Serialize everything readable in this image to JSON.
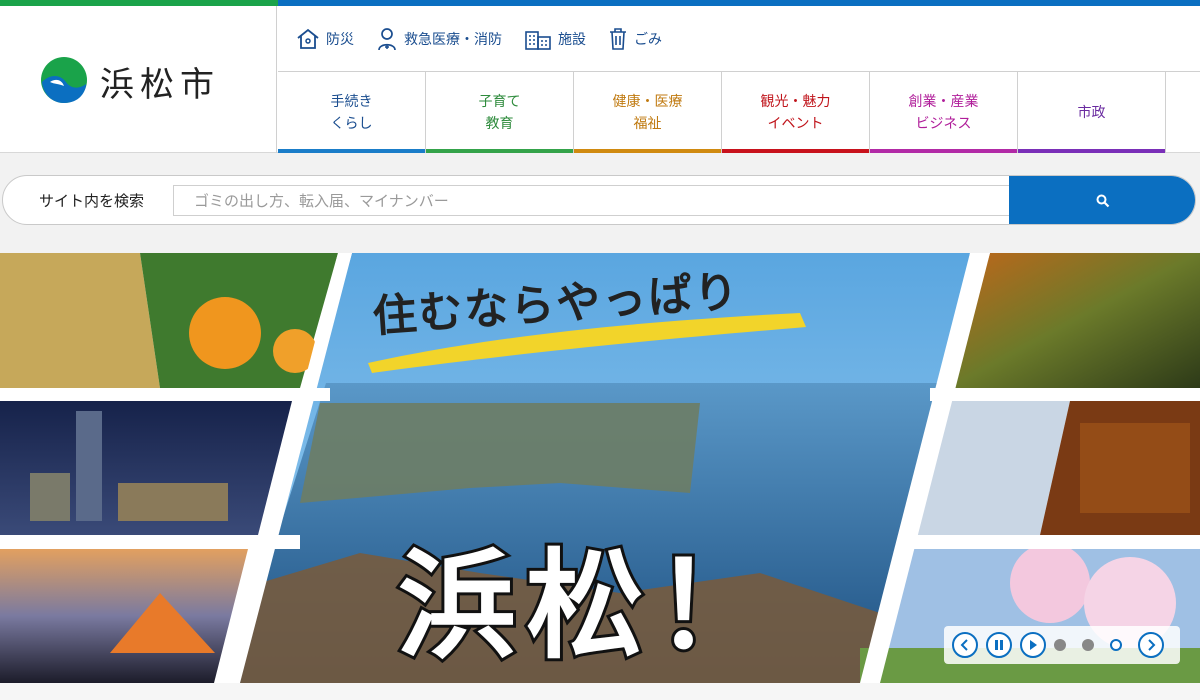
{
  "site": {
    "name": "浜松市"
  },
  "util_nav": [
    {
      "label": "防災",
      "icon": "house-icon"
    },
    {
      "label": "救急医療・消防",
      "icon": "medical-staff-icon"
    },
    {
      "label": "施設",
      "icon": "building-icon"
    },
    {
      "label": "ごみ",
      "icon": "trash-icon"
    }
  ],
  "main_nav": [
    {
      "label": "手続き\nくらし",
      "color": "#1a4d8f",
      "bar": "#1a7dc9"
    },
    {
      "label": "子育て\n教育",
      "color": "#2e8b3c",
      "bar": "#34a34a"
    },
    {
      "label": "健康・医療\n福祉",
      "color": "#c07a10",
      "bar": "#d08a10"
    },
    {
      "label": "観光・魅力\nイベント",
      "color": "#c0141b",
      "bar": "#c8121c"
    },
    {
      "label": "創業・産業\nビジネス",
      "color": "#b01e9a",
      "bar": "#b22aa6"
    },
    {
      "label": "市政",
      "color": "#6a2ba0",
      "bar": "#7a2fb8"
    }
  ],
  "search": {
    "label": "サイト内を検索",
    "placeholder": "ゴミの出し方、転入届、マイナンバー",
    "button_color": "#0b6fc1"
  },
  "hero": {
    "tagline": "住むならやっぱり",
    "headline": "浜松！",
    "slides_total": 3,
    "active_slide": 3
  },
  "colors": {
    "accent": "#0b6fc1",
    "green": "#1aa34a"
  }
}
